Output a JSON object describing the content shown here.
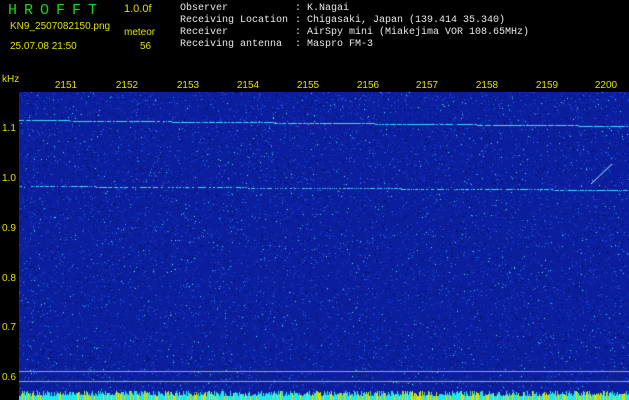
{
  "header": {
    "title": "HROFFT",
    "version": "1.0.0f",
    "filename": "KN9_2507082150.png",
    "mode": "meteor",
    "datetime": "25.07.08 21:50",
    "count": "56"
  },
  "info": [
    {
      "key": "Observer",
      "value": ": K.Nagai"
    },
    {
      "key": "Receiving Location",
      "value": ": Chigasaki, Japan (139.414 35.340)"
    },
    {
      "key": "Receiver",
      "value": ": AirSpy mini (Miakejima VOR 108.65MHz)"
    },
    {
      "key": "Receiving antenna",
      "value": ": Maspro FM-3"
    }
  ],
  "axis": {
    "unit": "kHz",
    "time_labels": [
      "2151",
      "2152",
      "2153",
      "2154",
      "2155",
      "2156",
      "2157",
      "2158",
      "2159",
      "2200"
    ],
    "freq_labels": [
      "1.1",
      "1.0",
      "0.9",
      "0.8",
      "0.7",
      "0.6"
    ]
  },
  "colors": {
    "background": "#000000",
    "waterfall_base": "#0b1f9e",
    "label_yellow": "#e0e000",
    "title_green": "#19d419",
    "info_text": "#e8e8e8",
    "noise_bottom": "#22e8e8"
  }
}
